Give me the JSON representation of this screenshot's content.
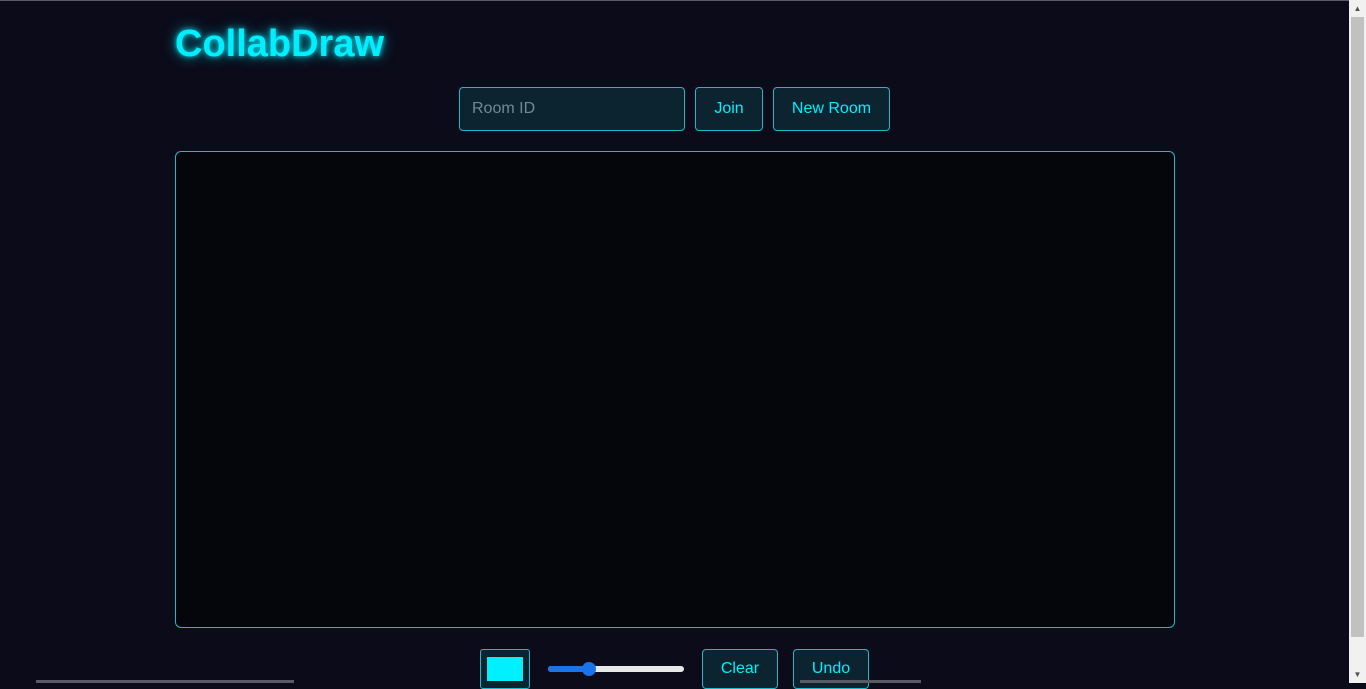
{
  "app": {
    "title": "CollabDraw"
  },
  "room": {
    "input_value": "",
    "input_placeholder": "Room ID",
    "join_label": "Join",
    "new_room_label": "New Room"
  },
  "toolbar": {
    "color_value": "#00f0ff",
    "brush_size_fraction": 0.3,
    "clear_label": "Clear",
    "undo_label": "Undo"
  },
  "icons": {
    "scroll_up": "triangle-up",
    "scroll_down": "triangle-down"
  },
  "colors": {
    "accent": "#00f0ff",
    "background": "#0b0b1a",
    "canvas": "#05050c",
    "border": "#1fb8c8",
    "slider": "#1a73e8"
  }
}
